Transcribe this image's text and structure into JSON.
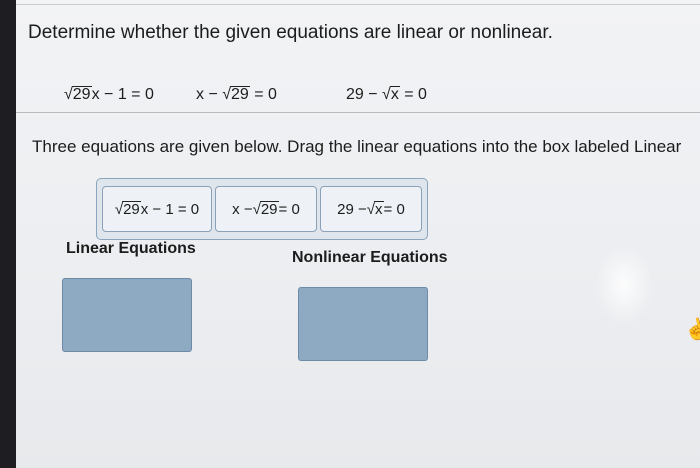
{
  "question1": "Determine whether the given equations are linear or nonlinear.",
  "equations": [
    {
      "before": "",
      "radicand": "29",
      "after": "x − 1 = 0"
    },
    {
      "before": "x − ",
      "radicand": "29",
      "after": " = 0"
    },
    {
      "before": "29 − ",
      "radicand": "x",
      "after": " = 0"
    }
  ],
  "question2": "Three equations are given below. Drag the linear equations into the box labeled Linear",
  "tiles": [
    {
      "before": "",
      "radicand": "29",
      "after": "x − 1 = 0"
    },
    {
      "before": "x − ",
      "radicand": "29",
      "after": " = 0"
    },
    {
      "before": "29 − ",
      "radicand": "x",
      "after": " = 0"
    }
  ],
  "linear_label": "Linear Equations",
  "nonlinear_label": "Nonlinear Equations",
  "colors": {
    "dropbox": "#8eaac2",
    "tile_border": "#8aa1b8"
  }
}
